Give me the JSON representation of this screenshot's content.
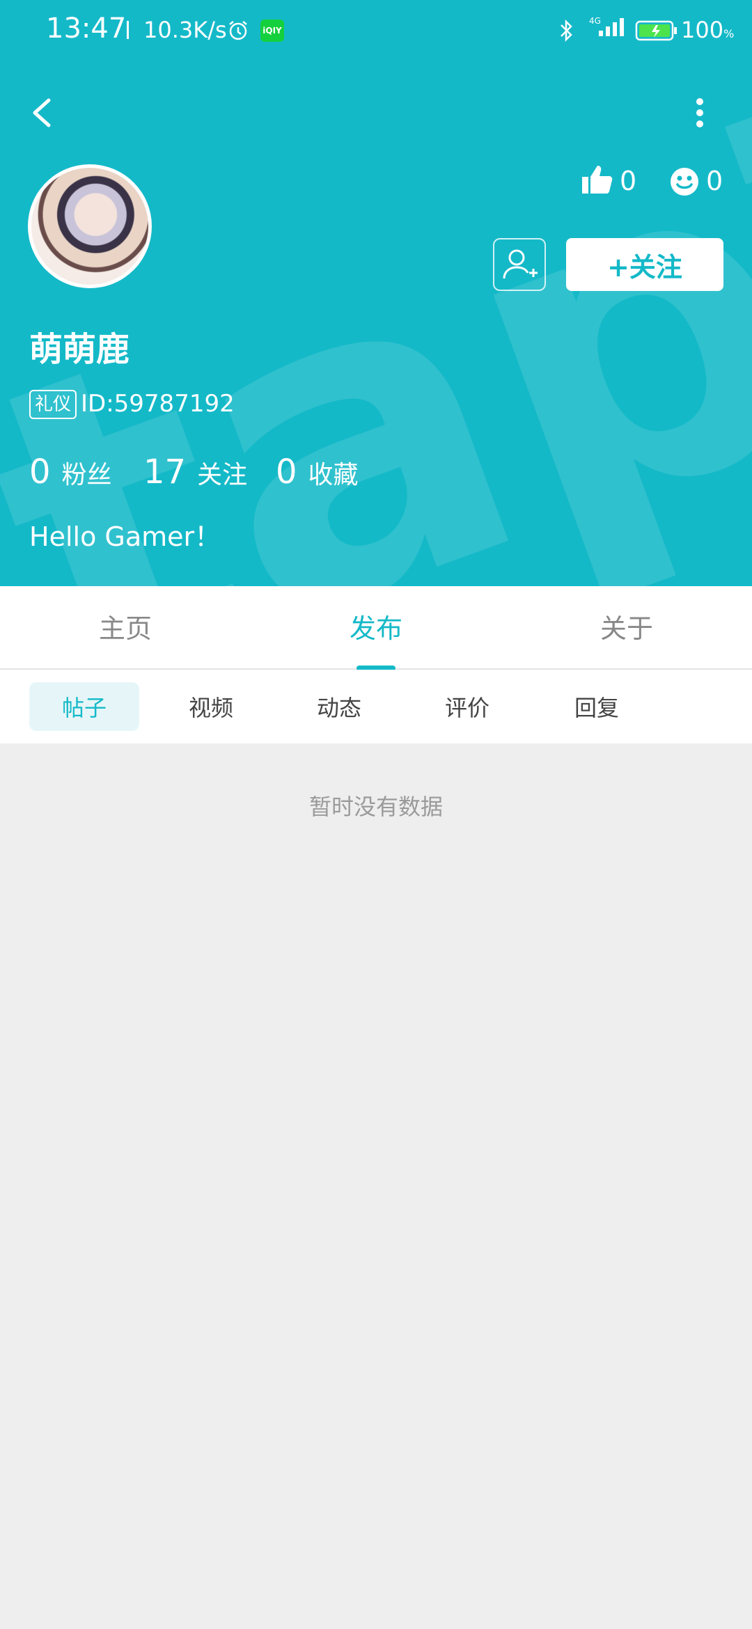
{
  "colors": {
    "accent": "#14b9c8",
    "background": "#eeeeee",
    "white": "#ffffff"
  },
  "status_bar": {
    "time": "13:47",
    "net_speed": "10.3K/s",
    "app_icon_text": "iQIY",
    "network": "4G",
    "battery": "100",
    "battery_unit": "%"
  },
  "profile": {
    "username": "萌萌鹿",
    "badge": "礼仪",
    "user_id": "ID:59787192",
    "likes": "0",
    "smiles": "0",
    "stats": [
      {
        "value": "0",
        "label": "粉丝"
      },
      {
        "value": "17",
        "label": "关注"
      },
      {
        "value": "0",
        "label": "收藏"
      }
    ],
    "bio": "Hello Gamer！",
    "follow_label": "+关注"
  },
  "tabs": [
    {
      "label": "主页"
    },
    {
      "label": "发布"
    },
    {
      "label": "关于"
    }
  ],
  "subtabs": [
    {
      "label": "帖子"
    },
    {
      "label": "视频"
    },
    {
      "label": "动态"
    },
    {
      "label": "评价"
    },
    {
      "label": "回复"
    }
  ],
  "empty_message": "暂时没有数据",
  "icons": [
    "back-arrow-icon",
    "more-dots-icon",
    "thumbs-up-icon",
    "smile-icon",
    "add-user-icon",
    "alarm-icon",
    "bluetooth-icon",
    "signal-icon",
    "battery-icon"
  ]
}
